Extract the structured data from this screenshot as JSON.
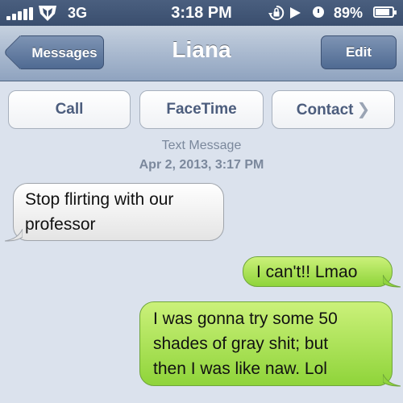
{
  "status_bar": {
    "network": "3G",
    "time": "3:18 PM",
    "battery_text": "89%",
    "battery_level": 0.89,
    "icons": [
      "signal-bars-icon",
      "carrier-logo-icon",
      "rotation-lock-icon",
      "play-icon",
      "alarm-icon",
      "battery-icon"
    ]
  },
  "nav": {
    "back_label": "Messages",
    "title": "Liana",
    "edit_label": "Edit"
  },
  "actions": {
    "call": "Call",
    "facetime": "FaceTime",
    "contact": "Contact",
    "contact_chevron": "❯"
  },
  "thread": {
    "message_type": "Text Message",
    "date": "Apr 2, 2013, 3:17 PM",
    "messages": [
      {
        "direction": "incoming",
        "lines": [
          "Stop flirting with our",
          "professor"
        ]
      },
      {
        "direction": "outgoing",
        "lines": [
          "I can't!! Lmao"
        ]
      },
      {
        "direction": "outgoing",
        "lines": [
          "I was gonna try some 50",
          "shades of gray shit; but",
          "then I was like naw. Lol"
        ]
      }
    ]
  },
  "colors": {
    "incoming_bubble": "#f2f2f2",
    "outgoing_bubble": "#a9e04f",
    "background": "#dbe2ed",
    "nav_button": "#5a7399"
  }
}
